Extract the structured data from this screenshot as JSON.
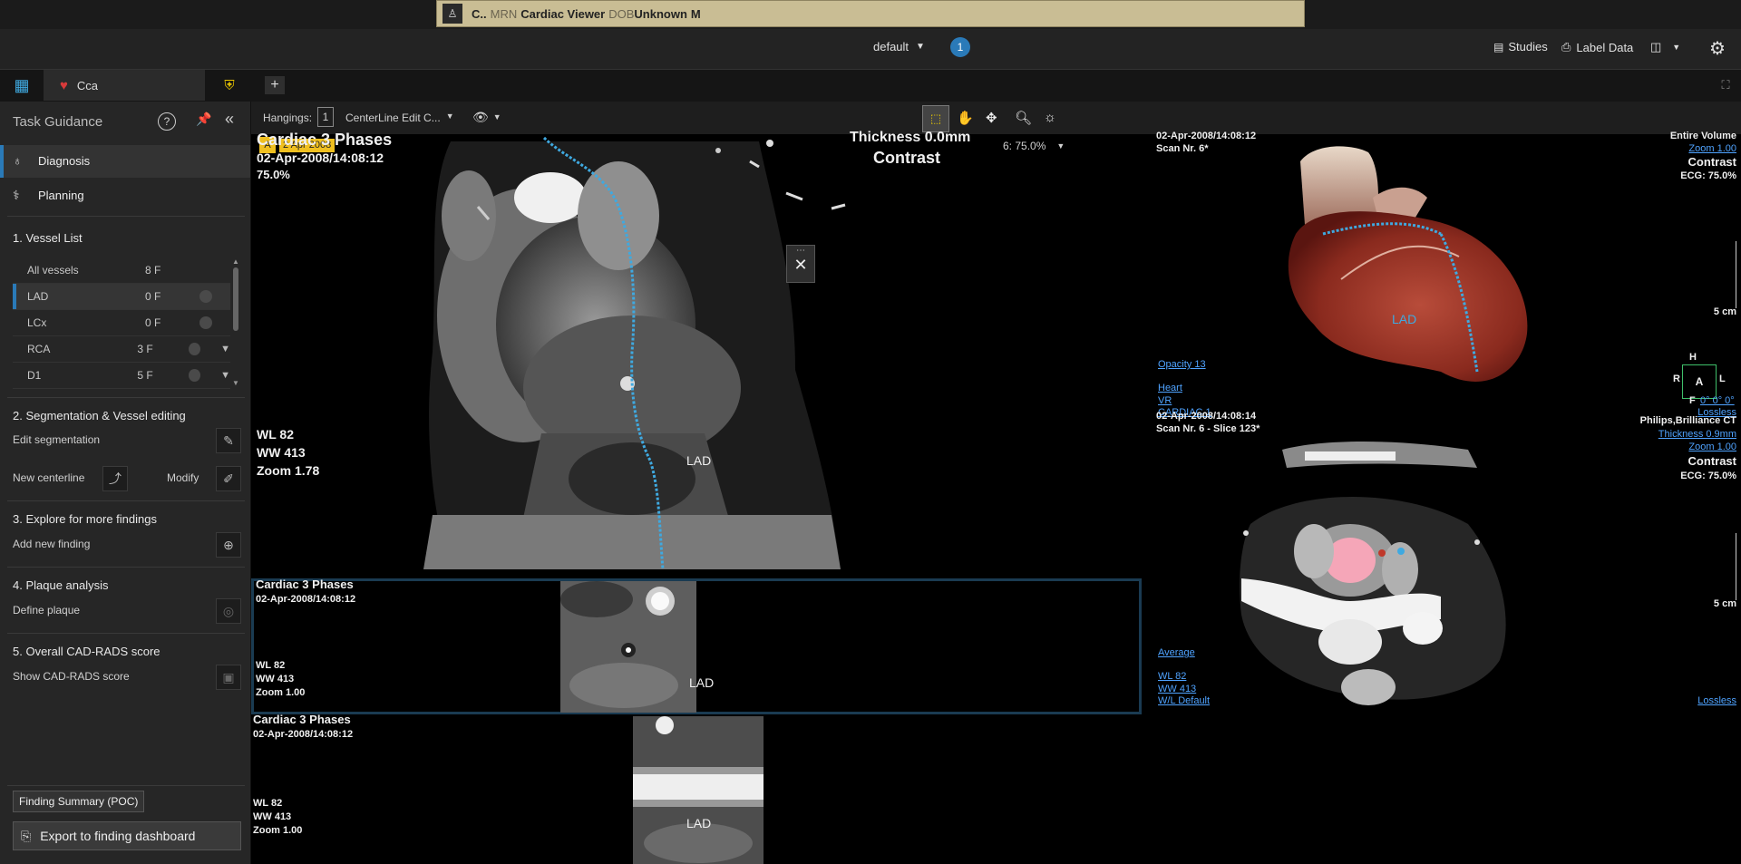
{
  "patient_banner": {
    "name": "C..",
    "mrn_label": "MRN",
    "app_name": "Cardiac Viewer",
    "dob_label": "DOB",
    "dob": "Unknown",
    "sex": "M"
  },
  "top_bar": {
    "layout": "default",
    "notification_count": "1",
    "studies": "Studies",
    "label_data": "Label Data"
  },
  "tabs": [
    {
      "label": "Cca"
    }
  ],
  "left_panel": {
    "title": "Task Guidance",
    "nav": [
      {
        "label": "Diagnosis"
      },
      {
        "label": "Planning"
      }
    ],
    "sections": {
      "vessel_list": "1. Vessel List",
      "segmentation": "2. Segmentation & Vessel editing",
      "explore": "3. Explore for more findings",
      "plaque": "4. Plaque analysis",
      "cadrads": "5. Overall CAD-RADS score"
    },
    "vessels": [
      {
        "name": "All vessels",
        "count": "8 F"
      },
      {
        "name": "LAD",
        "count": "0 F"
      },
      {
        "name": "LCx",
        "count": "0 F"
      },
      {
        "name": "RCA",
        "count": "3 F"
      },
      {
        "name": "D1",
        "count": "5 F"
      }
    ],
    "edit_segmentation": "Edit segmentation",
    "new_centerline": "New centerline",
    "modify": "Modify",
    "add_new_finding": "Add new finding",
    "define_plaque": "Define plaque",
    "show_cadrads": "Show CAD-RADS score",
    "finding_summary": "Finding Summary (POC)",
    "export": "Export to finding dashboard"
  },
  "viewer_toolbar": {
    "hangings_label": "Hangings:",
    "hangings_value": "1",
    "protocol": "CenterLine Edit C...",
    "series_info": "6: 75.0%",
    "date_tag": "2 Apr 2008"
  },
  "curved_view": {
    "title": "Cardiac 3 Phases",
    "datetime": "02-Apr-2008/14:08:12",
    "percent": "75.0%",
    "thickness": "Thickness 0.0mm",
    "contrast": "Contrast",
    "wl": "WL     82",
    "ww": "WW   413",
    "zoom": "Zoom 1.78",
    "vessel_label": "LAD"
  },
  "cross_view1": {
    "title": "Cardiac 3 Phases",
    "datetime": "02-Apr-2008/14:08:12",
    "wl": "WL     82",
    "ww": "WW    413",
    "zoom": "Zoom 1.00",
    "vessel_label": "LAD"
  },
  "cross_view2": {
    "title": "Cardiac 3 Phases",
    "datetime": "02-Apr-2008/14:08:12",
    "wl": "WL     82",
    "ww": "WW    413",
    "zoom": "Zoom 1.00",
    "vessel_label": "LAD"
  },
  "vr_view": {
    "datetime": "02-Apr-2008/14:08:12",
    "scan": "Scan Nr. 6*",
    "volume": "Entire Volume",
    "zoom": "Zoom 1.00",
    "contrast": "Contrast",
    "ecg": "ECG: 75.0%",
    "scale": "5 cm",
    "opacity": "Opacity 13",
    "preset": "Heart",
    "mode": "VR",
    "series": "CARDIAC 1",
    "vessel_label": "LAD",
    "orient_h": "H",
    "orient_r": "R",
    "orient_a": "A",
    "orient_l": "L",
    "orient_f": "F",
    "angles": "0° 0° 0°",
    "lossless": "Lossless"
  },
  "axial_view": {
    "datetime": "02-Apr-2008/14:08:14",
    "scan": "Scan Nr. 6 - Slice 123*",
    "scanner": "Philips,Brilliance CT",
    "thickness": "Thickness 0.9mm",
    "zoom": "Zoom 1.00",
    "contrast": "Contrast",
    "ecg": "ECG: 75.0%",
    "scale": "5 cm",
    "average": "Average",
    "wl": "WL     82",
    "ww": "WW    413",
    "wl_default": "W/L Default",
    "lossless": "Lossless"
  },
  "colors": {
    "accent": "#2a7ab8",
    "centerline": "#3fa9e0",
    "banner": "#c9bd94",
    "date_tag": "#f0c020"
  }
}
